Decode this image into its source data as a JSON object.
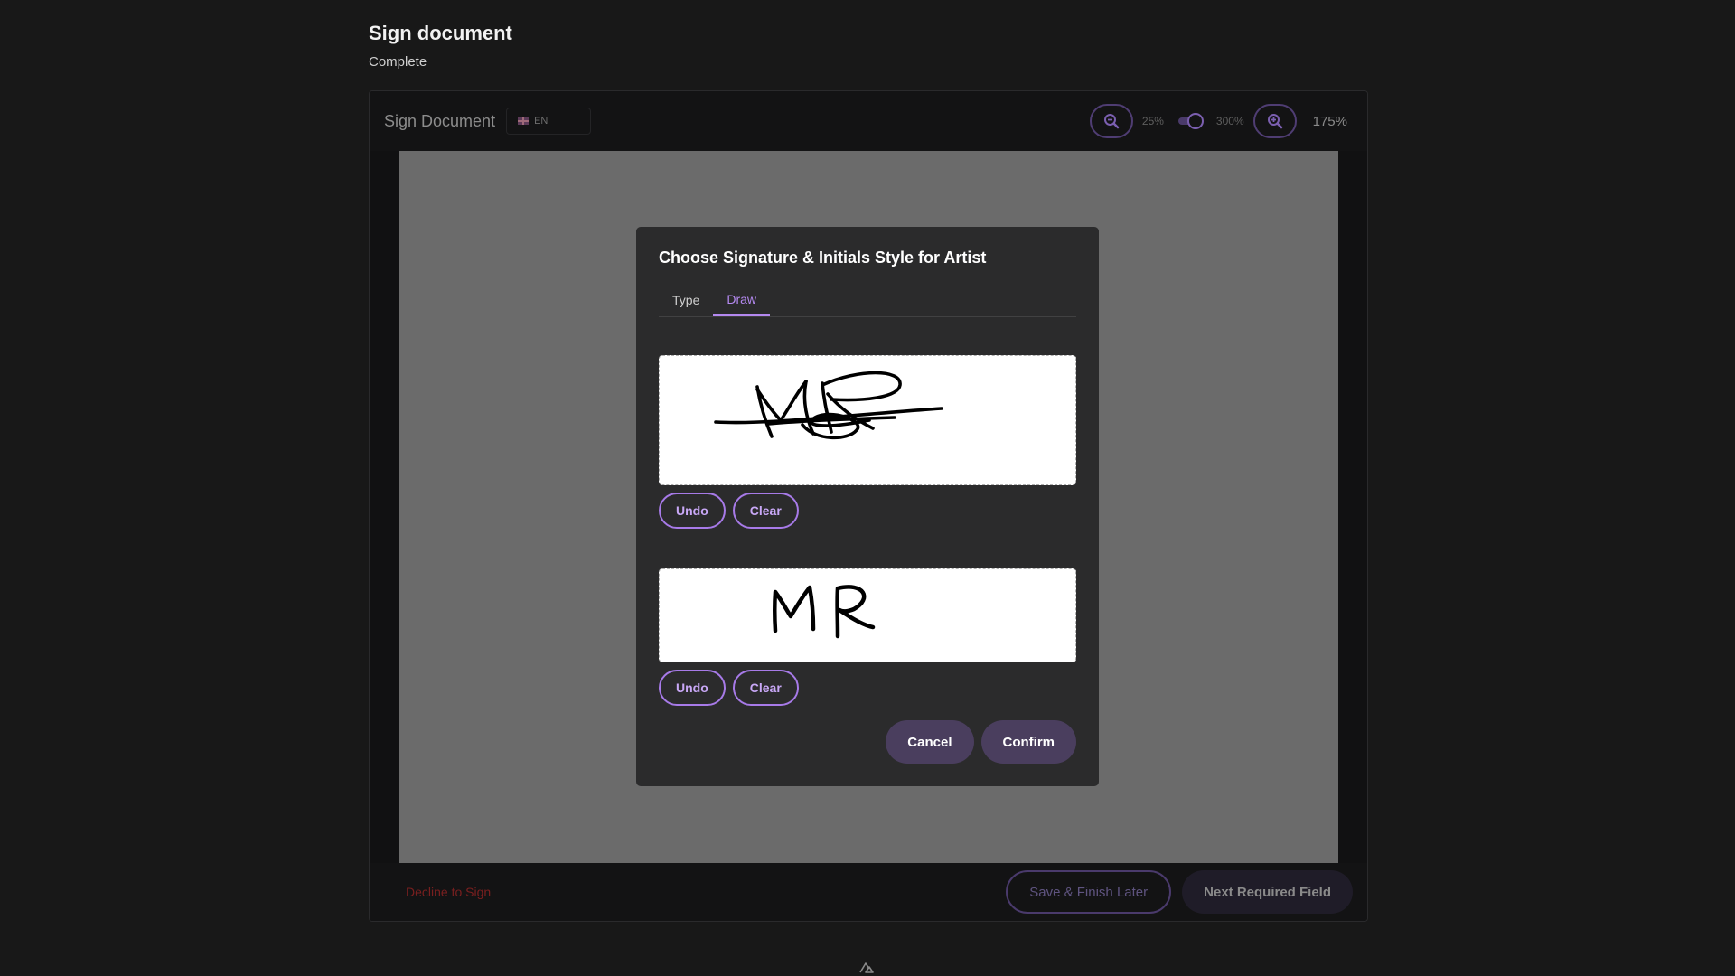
{
  "page": {
    "title": "Sign document",
    "status": "Complete"
  },
  "viewer": {
    "title": "Sign Document",
    "language": {
      "flag_icon": "uk-flag-icon",
      "code": "EN"
    },
    "zoom": {
      "zoom_out_icon": "zoom-out-icon",
      "zoom_in_icon": "zoom-in-icon",
      "min_label": "25%",
      "max_label": "300%",
      "current": "175%"
    }
  },
  "footer": {
    "decline": "Decline to Sign",
    "save_later": "Save & Finish Later",
    "next_field": "Next Required Field"
  },
  "modal": {
    "title": "Choose Signature & Initials Style for Artist",
    "tabs": [
      {
        "label": "Type",
        "active": false
      },
      {
        "label": "Draw",
        "active": true
      }
    ],
    "signature": {
      "undo": "Undo",
      "clear": "Clear"
    },
    "initials": {
      "undo": "Undo",
      "clear": "Clear"
    },
    "cancel": "Cancel",
    "confirm": "Confirm"
  },
  "colors": {
    "accent": "#b489f0",
    "background": "#181818",
    "modal_bg": "#2b2b2c",
    "document_page": "#6b6b6b",
    "decline_red": "#7a1f1f"
  }
}
